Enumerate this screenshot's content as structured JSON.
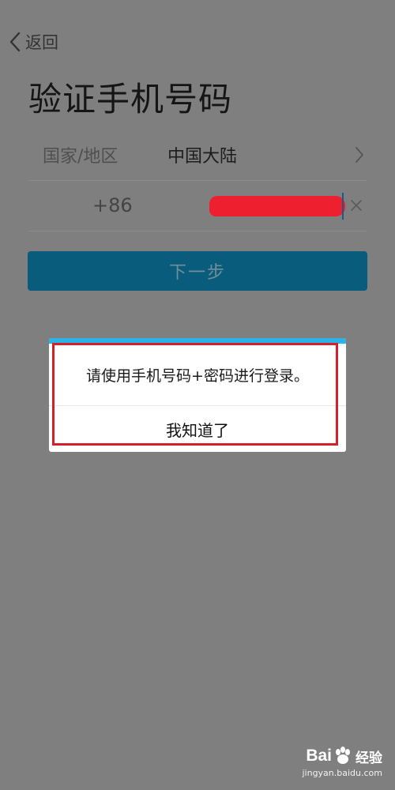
{
  "header": {
    "back_label": "返回",
    "title": "验证手机号码"
  },
  "form": {
    "region_label": "国家/地区",
    "region_value": "中国大陆",
    "country_code": "+86"
  },
  "next_button": {
    "label": "下一步"
  },
  "dialog": {
    "message": "请使用手机号码+密码进行登录。",
    "confirm_label": "我知道了"
  },
  "watermark": {
    "logo_text_left": "Bai",
    "logo_text_right": "经验",
    "url": "jingyan.baidu.com"
  },
  "colors": {
    "overlay_bg": "#7f7f7f",
    "primary_button": "#0a5c7c",
    "dialog_accent": "#2bb2e6",
    "highlight_red": "#d4202a",
    "redaction_red": "#ee2030"
  }
}
